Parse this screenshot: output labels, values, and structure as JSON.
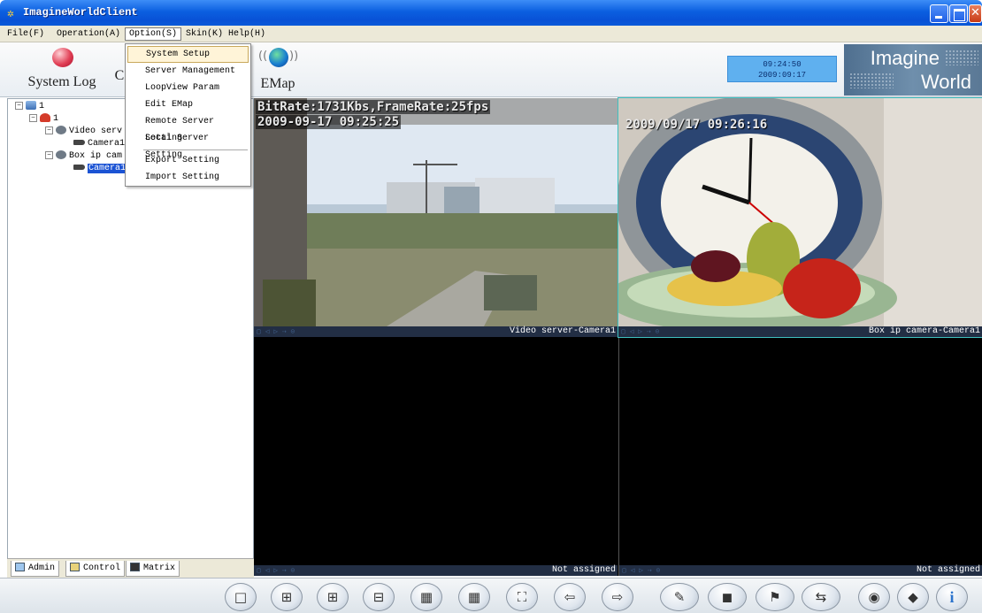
{
  "window": {
    "title": "ImagineWorldClient"
  },
  "menu": [
    {
      "label": "File(F)"
    },
    {
      "label": "Operation(A)"
    },
    {
      "label": "Option(S)"
    },
    {
      "label": "Skin(K)"
    },
    {
      "label": "Help(H)"
    }
  ],
  "toolbar": {
    "system_log_label": "System Log",
    "partial_label": "C",
    "emap_label": "EMap",
    "clock_time": "09:24:50",
    "clock_date": "2009:09:17",
    "brand_line1": "Imagine",
    "brand_line2": "World"
  },
  "option_menu": {
    "items": [
      "System Setup",
      "Server Management",
      "LoopView Param",
      "Edit EMap",
      "Remote Server Setting",
      "Local Server Setting",
      "Export Setting",
      "Import Setting"
    ],
    "highlighted": "System Setup"
  },
  "tree": {
    "root": "1",
    "group": "1",
    "video_server": "Video serv",
    "video_camera": "Camera1",
    "box_camera": "Box ip cam",
    "box_camera_child": "Camera1"
  },
  "left_tabs": [
    "Admin",
    "Control",
    "Matrix"
  ],
  "video": {
    "cell1_osd_line1": "BitRate:1731Kbs,FrameRate:25fps",
    "cell1_osd_line2": "2009-09-17 09:25:25",
    "cell1_name": "Video server-Camera1",
    "cell2_osd": "2009/09/17 09:26:16",
    "cell2_name": "Box ip camera-Camera1",
    "cell3_name": "Not assigned",
    "cell4_name": "Not assigned",
    "controls_glyphs": "▢ ◁ ▷ ⇢ ⊙"
  },
  "bottom_glyphs": {
    "view1": "□",
    "view4": "⊞",
    "view6": "⊞",
    "view8": "⊟",
    "view9": "▦",
    "view16": "▦",
    "fullscreen": "⛶",
    "prev": "⇦",
    "next": "⇨",
    "snap": "✎",
    "capture": "◼",
    "record": "⚑",
    "ptz": "⇆",
    "audio": "◉",
    "talk": "◆",
    "info": "i"
  }
}
